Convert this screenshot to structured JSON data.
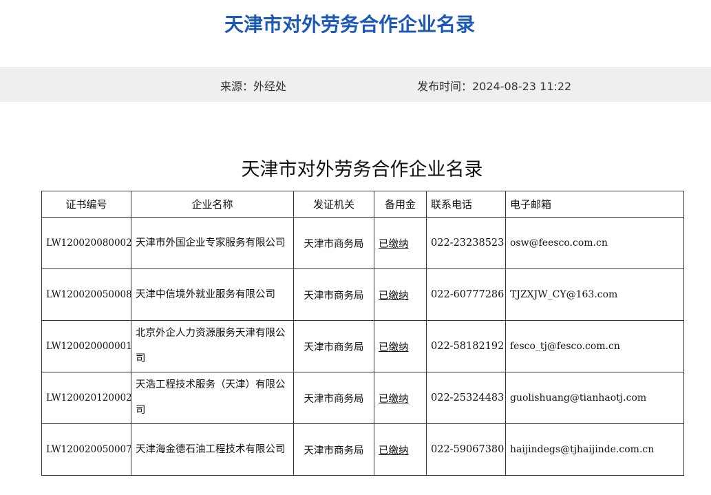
{
  "page": {
    "title": "天津市对外劳务合作企业名录",
    "source": "来源：外经处",
    "published": "发布时间：2024-08-23 11:22"
  },
  "document": {
    "title": "天津市对外劳务合作企业名录",
    "table": {
      "headers": {
        "cert_no": "证书编号",
        "company": "企业名称",
        "issuer": "发证机关",
        "reserve": "备用金",
        "phone": "联系电话",
        "email": "电子邮箱"
      },
      "rows": [
        {
          "cert_no": "LW120020080002",
          "company": "天津市外国企业专家服务有限公司",
          "issuer": "天津市商务局",
          "reserve": "已缴纳",
          "phone": "022-23238523",
          "email": "osw@feesco.com.cn"
        },
        {
          "cert_no": "LW120020050008",
          "company": "天津中信境外就业服务有限公司",
          "issuer": "天津市商务局",
          "reserve": "已缴纳",
          "phone": "022-60777286",
          "email": "TJZXJW_CY@163.com"
        },
        {
          "cert_no": "LW120020000001",
          "company": "北京外企人力资源服务天津有限公司",
          "issuer": "天津市商务局",
          "reserve": "已缴纳",
          "phone": "022-58182192",
          "email": "fesco_tj@fesco.com.cn"
        },
        {
          "cert_no": "LW120020120002",
          "company": "天浩工程技术服务（天津）有限公司",
          "issuer": "天津市商务局",
          "reserve": "已缴纳",
          "phone": "022-25324483",
          "email": "guolishuang@tianhaotj.com"
        },
        {
          "cert_no": "LW120020050007",
          "company": "天津海金德石油工程技术有限公司",
          "issuer": "天津市商务局",
          "reserve": "已缴纳",
          "phone": "022-59067380",
          "email": "haijindegs@tjhaijinde.com.cn"
        }
      ]
    }
  }
}
